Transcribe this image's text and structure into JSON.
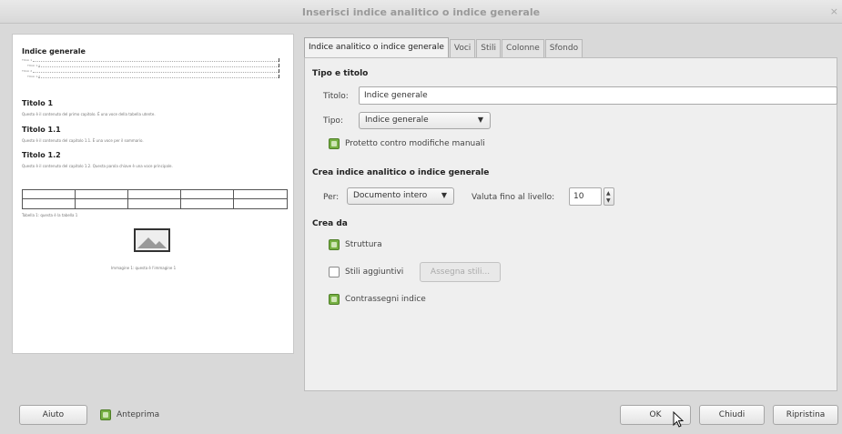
{
  "window": {
    "title": "Inserisci indice analitico o indice generale",
    "close": "×"
  },
  "preview": {
    "index_heading": "Indice generale",
    "index_entries": [
      "Titolo 1",
      "Titolo 1.1",
      "Titolo 2",
      "Titolo 1.2"
    ],
    "sections": [
      {
        "title": "Titolo 1",
        "body": "Questo è il contenuto del primo capitolo. È una voce della tabella utente."
      },
      {
        "title": "Titolo 1.1",
        "body": "Questo è il contenuto del capitolo 1.1. È una voce per il sommario."
      },
      {
        "title": "Titolo 1.2",
        "body": "Questo è il contenuto del capitolo 1.2. Questa parola chiave è una voce principale."
      }
    ],
    "table_caption": "Tabella 1: questa è la tabella 1",
    "image_caption": "Immagine 1: questa è l'immagine 1"
  },
  "tabs": [
    "Indice analitico o indice generale",
    "Voci",
    "Stili",
    "Colonne",
    "Sfondo"
  ],
  "type_section": {
    "heading": "Tipo e titolo",
    "title_label": "Titolo:",
    "title_value": "Indice generale",
    "type_label": "Tipo:",
    "type_value": "Indice generale",
    "protected_label": "Protetto contro modifiche manuali",
    "protected_checked": true
  },
  "create_section": {
    "heading": "Crea indice analitico o indice generale",
    "for_label": "Per:",
    "for_value": "Documento intero",
    "level_label": "Valuta fino al livello:",
    "level_value": "10"
  },
  "from_section": {
    "heading": "Crea da",
    "structure_label": "Struttura",
    "structure_checked": true,
    "extra_styles_label": "Stili aggiuntivi",
    "extra_styles_checked": false,
    "assign_styles_label": "Assegna stili...",
    "index_marks_label": "Contrassegni indice",
    "index_marks_checked": true
  },
  "footer": {
    "help": "Aiuto",
    "preview_label": "Anteprima",
    "preview_checked": true,
    "ok": "OK",
    "close": "Chiudi",
    "reset": "Ripristina"
  }
}
